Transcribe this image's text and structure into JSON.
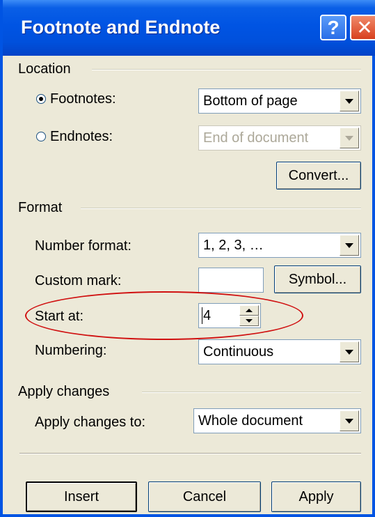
{
  "window": {
    "title": "Footnote and Endnote",
    "help_glyph": "?",
    "close_glyph": "✕"
  },
  "location": {
    "group_label": "Location",
    "footnotes": {
      "label": "Footnotes:",
      "selected": true,
      "value": "Bottom of page"
    },
    "endnotes": {
      "label": "Endnotes:",
      "selected": false,
      "value": "End of document",
      "disabled": true
    },
    "convert_label": "Convert..."
  },
  "format": {
    "group_label": "Format",
    "number_format": {
      "label": "Number format:",
      "value": "1, 2, 3, …"
    },
    "custom_mark": {
      "label": "Custom mark:",
      "value": ""
    },
    "symbol_label": "Symbol...",
    "start_at": {
      "label": "Start at:",
      "value": "4"
    },
    "numbering": {
      "label": "Numbering:",
      "value": "Continuous"
    }
  },
  "apply_changes": {
    "group_label": "Apply changes",
    "apply_to": {
      "label": "Apply changes to:",
      "value": "Whole document"
    }
  },
  "buttons": {
    "insert": "Insert",
    "cancel": "Cancel",
    "apply": "Apply"
  },
  "colors": {
    "titlebar": "#0054e3",
    "dialog_bg": "#ece9d8",
    "highlight": "#d01010"
  }
}
